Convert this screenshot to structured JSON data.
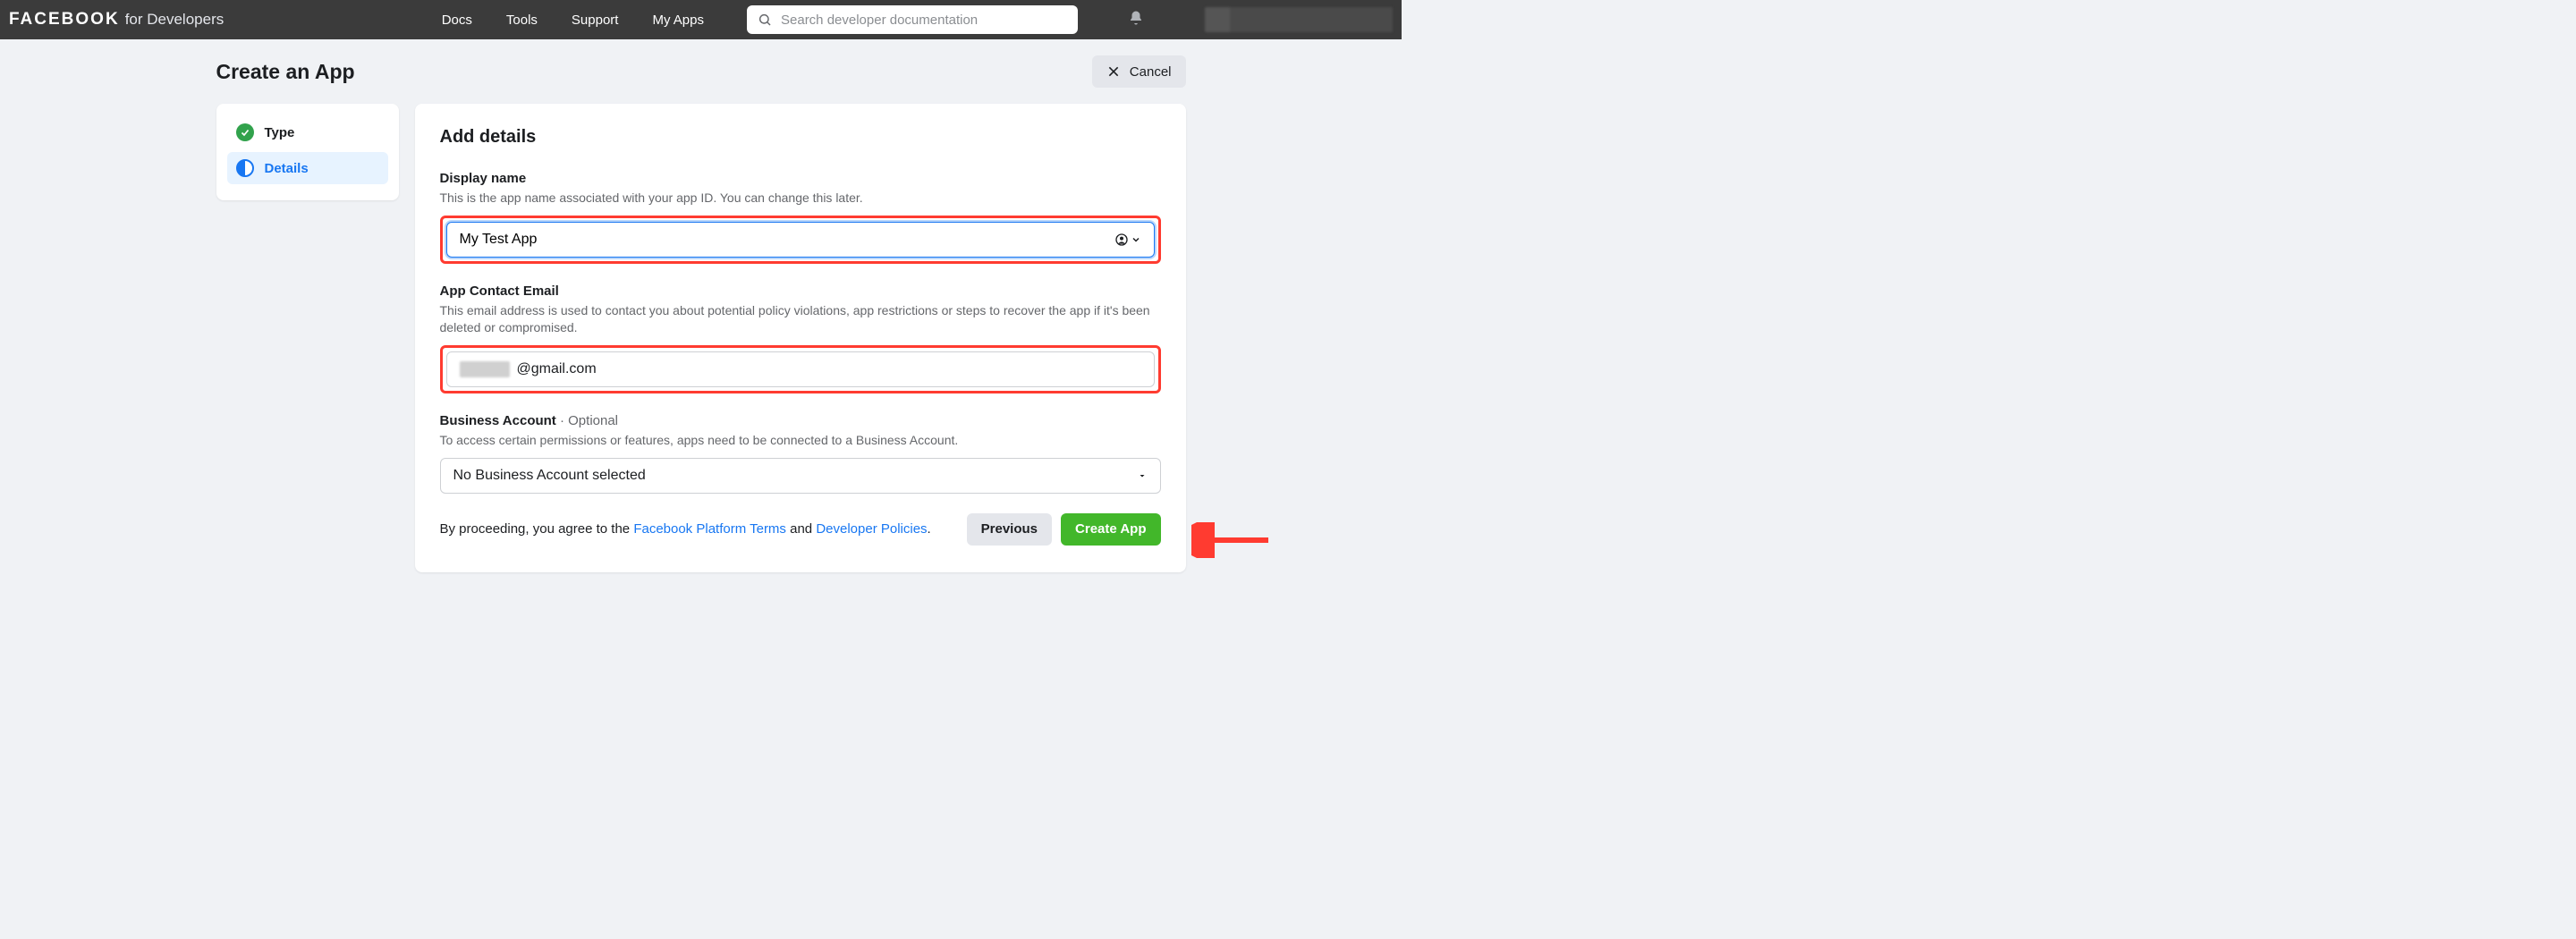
{
  "header": {
    "brand_main": "FACEBOOK",
    "brand_sub": "for Developers",
    "nav": {
      "docs": "Docs",
      "tools": "Tools",
      "support": "Support",
      "myapps": "My Apps"
    },
    "search_placeholder": "Search developer documentation"
  },
  "page": {
    "title": "Create an App",
    "cancel": "Cancel"
  },
  "stepper": {
    "type": "Type",
    "details": "Details"
  },
  "form": {
    "heading": "Add details",
    "display_name": {
      "label": "Display name",
      "help": "This is the app name associated with your app ID. You can change this later.",
      "value": "My Test App"
    },
    "contact_email": {
      "label": "App Contact Email",
      "help": "This email address is used to contact you about potential policy violations, app restrictions or steps to recover the app if it's been deleted or compromised.",
      "value_suffix": "@gmail.com"
    },
    "business": {
      "label": "Business Account",
      "optional": " · Optional",
      "help": "To access certain permissions or features, apps need to be connected to a Business Account.",
      "selected": "No Business Account selected"
    },
    "agree_prefix": "By proceeding, you agree to the ",
    "agree_link1": "Facebook Platform Terms",
    "agree_mid": " and ",
    "agree_link2": "Developer Policies",
    "agree_suffix": ".",
    "previous": "Previous",
    "create": "Create App"
  }
}
